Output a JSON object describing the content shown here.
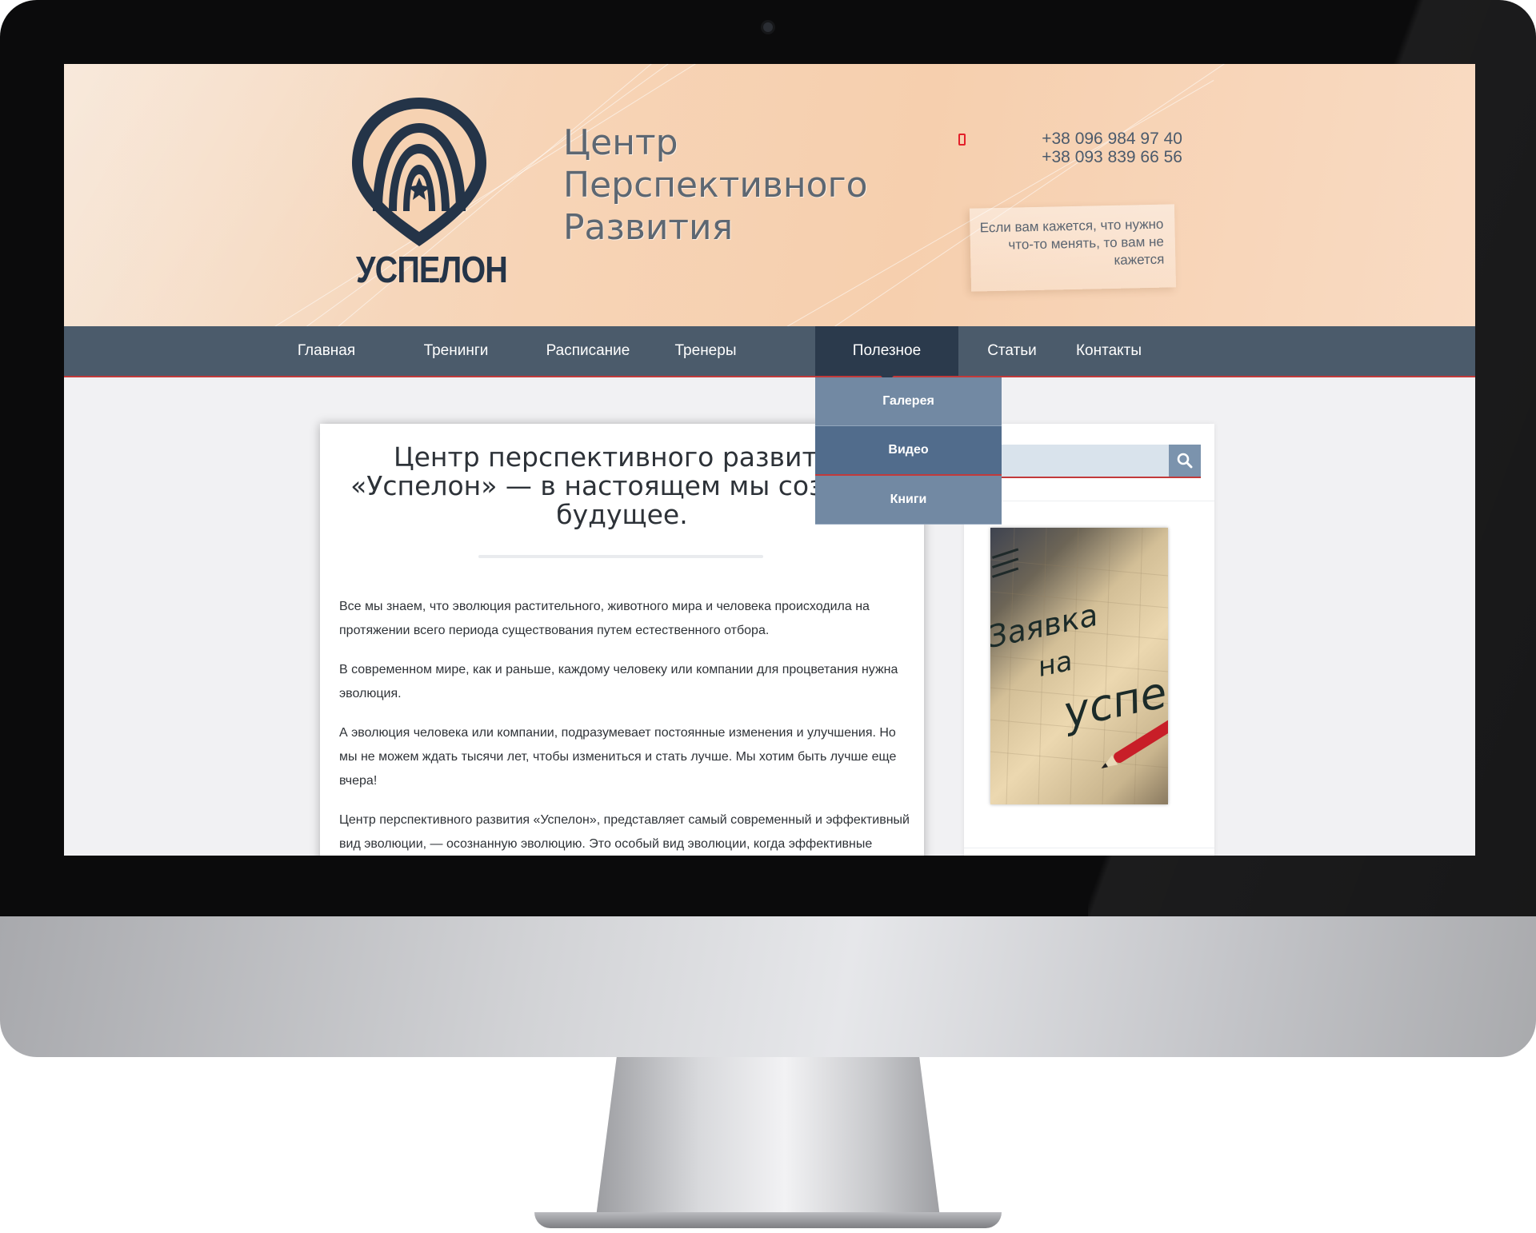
{
  "header": {
    "logo_text": "УСПЕЛОН",
    "title_lines": [
      "Центр",
      "Перспективного",
      "Развития"
    ],
    "phones": [
      "+38 096 984 97 40",
      "+38 093 839 66 56"
    ],
    "quote": "Если вам кажется, что нужно что-то менять, то вам не кажется"
  },
  "nav": {
    "items": [
      {
        "label": "Главная"
      },
      {
        "label": "Тренинги"
      },
      {
        "label": "Расписание"
      },
      {
        "label": "Тренеры"
      },
      {
        "label": "Полезное",
        "active": true
      },
      {
        "label": "Статьи"
      },
      {
        "label": "Контакты"
      }
    ],
    "dropdown": [
      {
        "label": "Галерея"
      },
      {
        "label": "Видео",
        "hovered": true
      },
      {
        "label": "Книги"
      }
    ]
  },
  "article": {
    "title_lines": [
      "Центр перспективного развития",
      "«Успелон» — в настоящем мы создаём",
      "будущее."
    ],
    "paragraphs": [
      "Все мы знаем, что эволюция растительного, животного мира и человека происходила на протяжении всего периода существования путем естественного отбора.",
      "В современном мире, как и раньше, каждому человеку или компании для процветания нужна эволюция.",
      "А эволюция человека или компании, подразумевает постоянные изменения и улучшения. Но мы не можем ждать тысячи лет, чтобы измениться и стать лучше. Мы хотим быть лучше еще вчера!",
      "Центр перспективного развития «Успелон», представляет самый современный и эффективный вид эволюции, — осознанную эволюцию. Это особый вид эволюции, когда эффективные перемены происходят быстро, ярко и в том направлении которое"
    ]
  },
  "sidebar": {
    "search": {
      "placeholder": ""
    },
    "image_caption_lines": [
      "Заявка",
      "на",
      "успех"
    ]
  },
  "colors": {
    "nav_bg": "#4b5b6b",
    "nav_active": "#2b3a4c",
    "accent_red": "#c23a3a",
    "dropdown_bg": "#7289a3",
    "logo_navy": "#243448"
  },
  "icons": {
    "phone": "phone-icon",
    "search": "search-icon",
    "logo": "arch-star-logo-icon"
  }
}
